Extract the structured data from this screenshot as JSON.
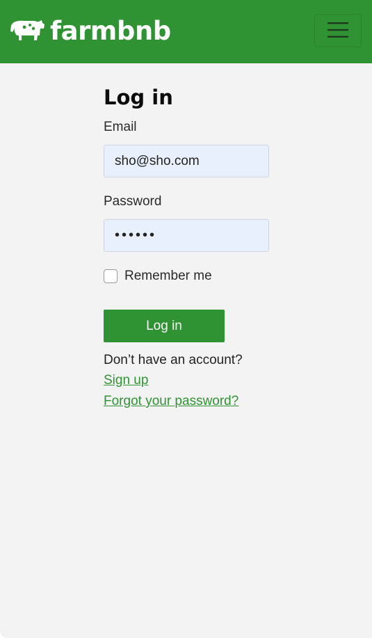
{
  "navbar": {
    "brand_name": "farmbnb",
    "logo_icon": "cow-icon",
    "menu_icon": "hamburger-menu-icon",
    "background_color": "#2f9334"
  },
  "login": {
    "title": "Log in",
    "email_label": "Email",
    "email_value": "sho@sho.com",
    "password_label": "Password",
    "password_value": "••••••",
    "remember_label": "Remember me",
    "remember_checked": false,
    "submit_label": "Log in",
    "no_account_text": "Don’t have an account?",
    "signup_link": "Sign up",
    "forgot_link": "Forgot your password?"
  },
  "colors": {
    "accent": "#2f9334",
    "page_background": "#f3f3f3",
    "input_background": "#e8effd"
  }
}
